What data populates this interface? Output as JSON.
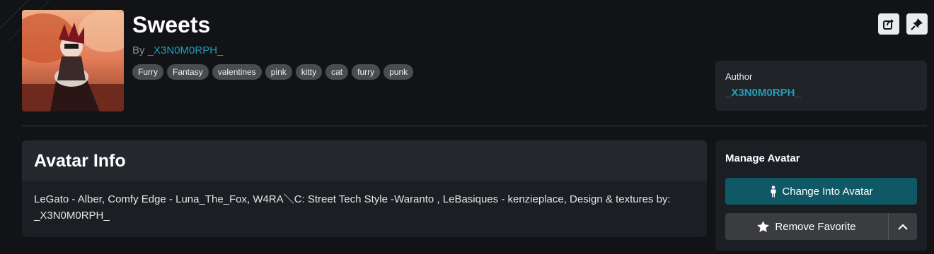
{
  "avatar": {
    "title": "Sweets",
    "by_prefix": "By",
    "author_name": "_X3N0M0RPH_",
    "thumbnail_icon": "avatar-thumbnail-image",
    "tags": [
      "Furry",
      "Fantasy",
      "valentines",
      "pink",
      "kitty",
      "cat",
      "furry",
      "punk"
    ]
  },
  "header_actions": {
    "share_icon": "share-icon",
    "pin_icon": "pin-icon"
  },
  "author_card": {
    "label": "Author",
    "name": "_X3N0M0RPH_"
  },
  "info": {
    "heading": "Avatar Info",
    "description": "LeGato - Alber, Comfy Edge - Luna_The_Fox, W4RA＼C: Street Tech Style -Waranto , LeBasiques - kenzieplace, Design  & textures by: _X3N0M0RPH_"
  },
  "manage": {
    "heading": "Manage Avatar",
    "change_label": "Change Into Avatar",
    "change_icon": "person-icon",
    "favorite_label": "Remove Favorite",
    "favorite_icon": "star-icon",
    "expand_icon": "chevron-up-icon"
  },
  "colors": {
    "background": "#111317",
    "accent": "#1e9fb8",
    "primary_button": "#0f5866",
    "card": "#1b1e22"
  }
}
